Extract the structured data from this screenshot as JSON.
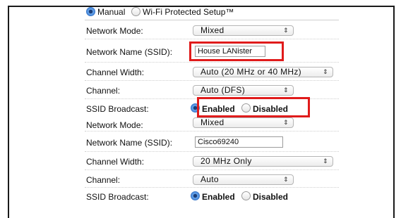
{
  "mode": {
    "manual": "Manual",
    "wps": "Wi-Fi Protected Setup™"
  },
  "labels": {
    "network_mode": "Network Mode:",
    "ssid": "Network Name (SSID):",
    "channel_width": "Channel Width:",
    "channel": "Channel:",
    "ssid_broadcast": "SSID Broadcast:"
  },
  "broadcast": {
    "enabled": "Enabled",
    "disabled": "Disabled"
  },
  "band1": {
    "network_mode": "Mixed",
    "ssid": "House LANister",
    "channel_width": "Auto (20 MHz or 40 MHz)",
    "channel": "Auto (DFS)"
  },
  "band2": {
    "network_mode": "Mixed",
    "ssid": "Cisco69240",
    "channel_width": "20 MHz Only",
    "channel": "Auto"
  },
  "icons": {
    "select_arrow": "⇕"
  },
  "colors": {
    "highlight": "#e01b1b",
    "radio_checked": "#2f6fd0"
  }
}
